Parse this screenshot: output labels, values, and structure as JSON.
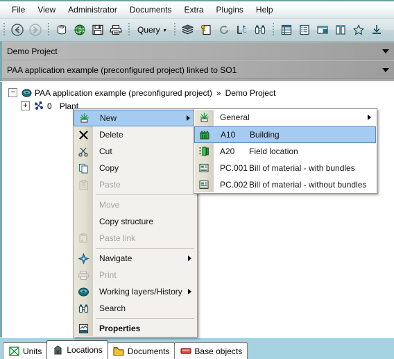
{
  "menubar": {
    "items": [
      {
        "label": "File"
      },
      {
        "label": "View"
      },
      {
        "label": "Administrator"
      },
      {
        "label": "Documents"
      },
      {
        "label": "Extra"
      },
      {
        "label": "Plugins"
      },
      {
        "label": "Help"
      }
    ]
  },
  "toolbar": {
    "query_label": "Query",
    "query_caret": "▾",
    "icons": [
      {
        "name": "back-arrow-icon"
      },
      {
        "name": "forward-arrow-icon"
      },
      {
        "name": "database-icon"
      },
      {
        "name": "globe-icon"
      },
      {
        "name": "save-icon"
      },
      {
        "name": "print-icon"
      },
      {
        "name": "layers-icon"
      },
      {
        "name": "key-document-icon"
      },
      {
        "name": "refresh-icon"
      },
      {
        "name": "redirect-icon"
      },
      {
        "name": "binoculars-icon"
      },
      {
        "name": "table-icon"
      },
      {
        "name": "list-icon"
      },
      {
        "name": "form-icon"
      },
      {
        "name": "columns-icon"
      },
      {
        "name": "favorite-star-icon"
      },
      {
        "name": "download-icon"
      }
    ]
  },
  "combos": [
    {
      "value": "Demo Project"
    },
    {
      "value": "PAA application example (preconfigured project)   linked to SO1"
    }
  ],
  "tree": {
    "root": {
      "expander": "−",
      "icon": "project-sphere-icon",
      "label": "PAA application example (preconfigured project)",
      "separator": "»",
      "suffix": "Demo Project"
    },
    "child": {
      "expander": "+",
      "icon": "plant-icon",
      "number": "0",
      "label": "Plant"
    }
  },
  "context_menu": {
    "items": [
      {
        "label": "New",
        "icon": "new-plant-icon",
        "state": "selected",
        "submenu": true
      },
      {
        "label": "Delete",
        "icon": "delete-x-icon",
        "state": "normal",
        "submenu": false
      },
      {
        "label": "Cut",
        "icon": "scissors-icon",
        "state": "normal",
        "submenu": false
      },
      {
        "label": "Copy",
        "icon": "copy-icon",
        "state": "normal",
        "submenu": false
      },
      {
        "label": "Paste",
        "icon": "paste-icon",
        "state": "disabled",
        "submenu": false
      },
      {
        "label": "Move",
        "icon": "none",
        "state": "disabled",
        "submenu": false,
        "separator_before": true
      },
      {
        "label": "Copy structure",
        "icon": "none",
        "state": "normal",
        "submenu": false
      },
      {
        "label": "Paste link",
        "icon": "paste-link-icon",
        "state": "disabled",
        "submenu": false
      },
      {
        "label": "Navigate",
        "icon": "navigate-icon",
        "state": "normal",
        "submenu": true,
        "separator_before": true
      },
      {
        "label": "Print",
        "icon": "print-icon",
        "state": "disabled",
        "submenu": false
      },
      {
        "label": "Working layers/History",
        "icon": "layers-sphere-icon",
        "state": "normal",
        "submenu": true
      },
      {
        "label": "Search",
        "icon": "binoculars-icon",
        "state": "normal",
        "submenu": false
      },
      {
        "label": "Properties",
        "icon": "properties-icon",
        "state": "bold",
        "submenu": false,
        "separator_before": true
      }
    ]
  },
  "submenu": {
    "items": [
      {
        "code": "",
        "label": "General",
        "icon": "new-plant-icon",
        "state": "normal",
        "submenu": true
      },
      {
        "code": "A10",
        "label": "Building",
        "icon": "building-icon",
        "state": "selected",
        "submenu": false
      },
      {
        "code": "A20",
        "label": "Field location",
        "icon": "field-icon",
        "state": "normal",
        "submenu": false
      },
      {
        "code": "PC.001",
        "label": "Bill of material - with bundles",
        "icon": "document-icon",
        "state": "normal",
        "submenu": false
      },
      {
        "code": "PC.002",
        "label": "Bill of material - without bundles",
        "icon": "document-icon",
        "state": "normal",
        "submenu": false
      }
    ]
  },
  "tabs": [
    {
      "label": "Units",
      "icon": "units-icon",
      "active": false
    },
    {
      "label": "Locations",
      "icon": "locations-icon",
      "active": true
    },
    {
      "label": "Documents",
      "icon": "documents-icon",
      "active": false
    },
    {
      "label": "Base objects",
      "icon": "base-objects-icon",
      "active": false
    }
  ],
  "colors": {
    "accent_teal": "#6b9fa5",
    "toolbar": "#c3d5d9",
    "selection_blue": "#a6cbf0",
    "tabstrip_blue": "#a5d3e2",
    "combo_gray": "#adadad",
    "menu_gutter": "#e2e0d2"
  }
}
